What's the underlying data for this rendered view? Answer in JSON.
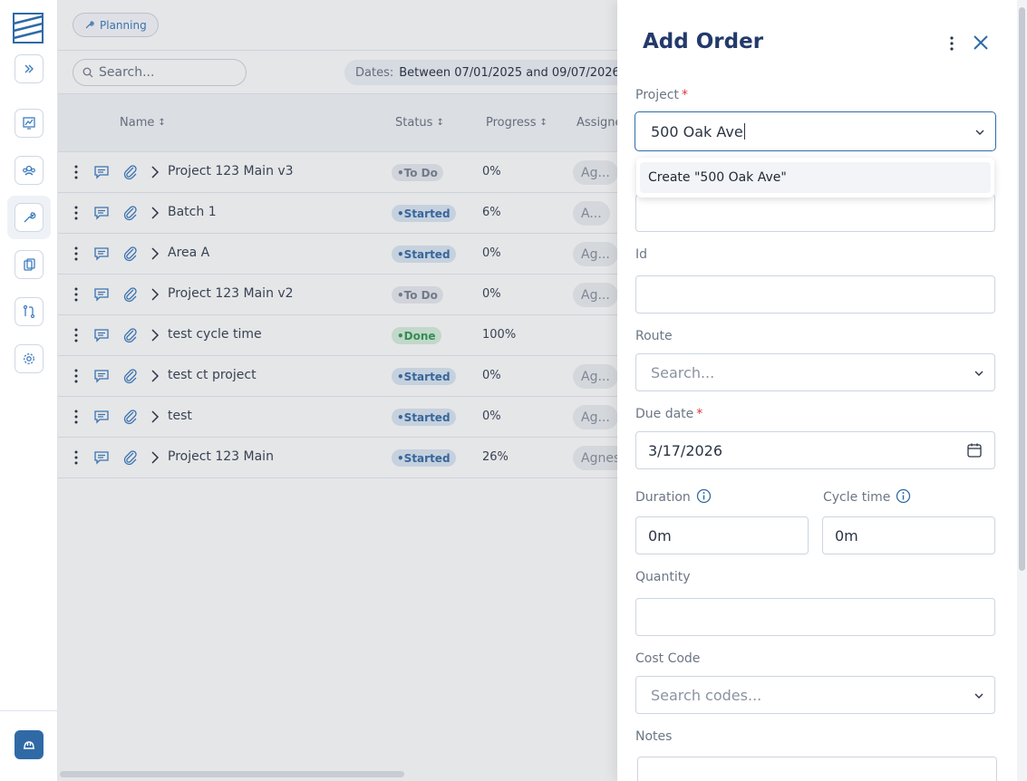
{
  "breadcrumb_chip": "Planning",
  "search": {
    "placeholder": "Search..."
  },
  "date_filter": {
    "label": "Dates:",
    "value": "Between 07/01/2025 and 09/07/2026"
  },
  "table": {
    "headers": {
      "name": "Name",
      "status": "Status",
      "progress": "Progress",
      "assignee": "Assigne"
    },
    "rows": [
      {
        "name": "Project 123 Main v3",
        "status": "To Do",
        "progress": "0%",
        "assignee": "Ag..."
      },
      {
        "name": "Batch 1",
        "status": "Started",
        "progress": "6%",
        "assignee": "A..."
      },
      {
        "name": "Area A",
        "status": "Started",
        "progress": "0%",
        "assignee": "Ag..."
      },
      {
        "name": "Project 123 Main v2",
        "status": "To Do",
        "progress": "0%",
        "assignee": "Ag..."
      },
      {
        "name": "test cycle time",
        "status": "Done",
        "progress": "100%",
        "assignee": ""
      },
      {
        "name": "test ct project",
        "status": "Started",
        "progress": "0%",
        "assignee": "Ag..."
      },
      {
        "name": "test",
        "status": "Started",
        "progress": "0%",
        "assignee": "Ag..."
      },
      {
        "name": "Project 123 Main",
        "status": "Started",
        "progress": "26%",
        "assignee": "Agnes"
      }
    ]
  },
  "drawer": {
    "title": "Add Order",
    "project": {
      "label": "Project",
      "value": "500 Oak Ave"
    },
    "dropdown_option": "Create \"500 Oak Ave\"",
    "id": {
      "label": "Id",
      "value": ""
    },
    "route": {
      "label": "Route",
      "placeholder": "Search..."
    },
    "due_date": {
      "label": "Due date",
      "value": "3/17/2026"
    },
    "duration": {
      "label": "Duration",
      "value": "0m"
    },
    "cycle_time": {
      "label": "Cycle time",
      "value": "0m"
    },
    "quantity": {
      "label": "Quantity",
      "value": ""
    },
    "cost_code": {
      "label": "Cost Code",
      "placeholder": "Search codes..."
    },
    "notes": {
      "label": "Notes"
    },
    "required_mark": "*"
  },
  "colors": {
    "accent": "#2f6aa6",
    "title": "#233a6b",
    "required": "#d9363e"
  },
  "icons": [
    "logo-icon",
    "expand-icon",
    "dashboard-icon",
    "team-icon",
    "planning-icon",
    "clipboard-icon",
    "routes-icon",
    "settings-icon",
    "helmet-icon",
    "search-icon",
    "close-icon",
    "more-vertical-icon",
    "comment-icon",
    "paperclip-icon",
    "chevron-right-icon",
    "chevron-down-icon",
    "calendar-icon",
    "info-icon"
  ]
}
